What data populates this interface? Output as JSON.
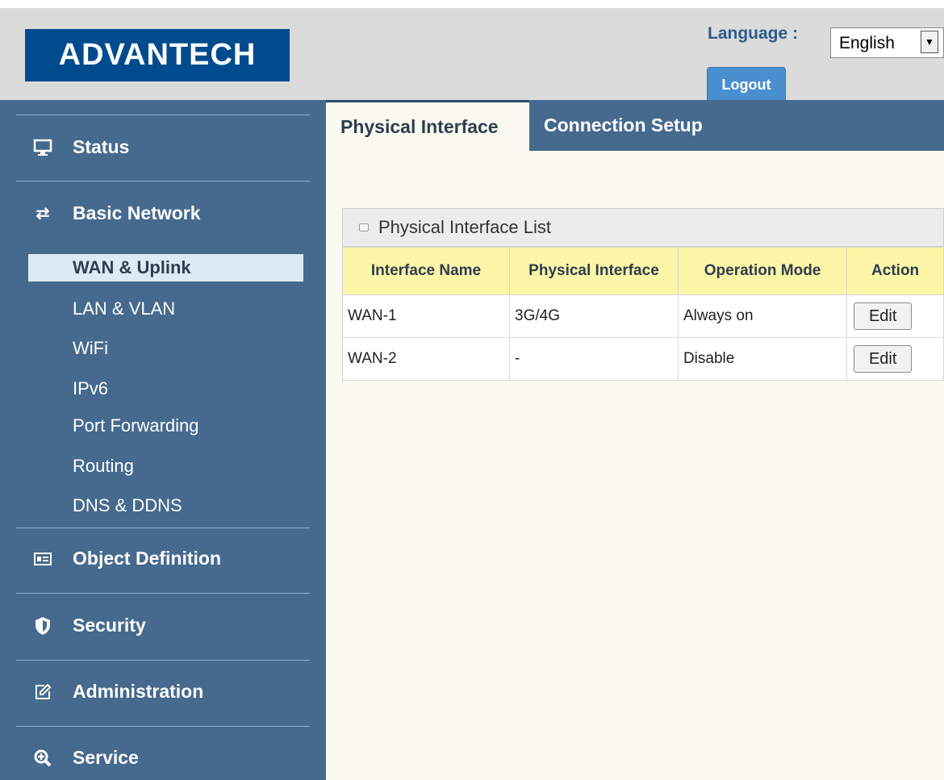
{
  "header": {
    "logo_text": "ADVANTECH",
    "language_label": "Language :",
    "language_value": "English",
    "logout_label": "Logout"
  },
  "sidebar": {
    "status": "Status",
    "basic_network": "Basic Network",
    "items": [
      "WAN & Uplink",
      "LAN & VLAN",
      "WiFi",
      "IPv6",
      "Port Forwarding",
      "Routing",
      "DNS & DDNS"
    ],
    "object_definition": "Object Definition",
    "security": "Security",
    "administration": "Administration",
    "service": "Service"
  },
  "tabs": [
    "Physical Interface",
    "Connection Setup"
  ],
  "panel": {
    "title": "Physical Interface List",
    "columns": [
      "Interface Name",
      "Physical Interface",
      "Operation Mode",
      "Action"
    ],
    "rows": [
      {
        "name": "WAN-1",
        "physical": "3G/4G",
        "mode": "Always on",
        "action": "Edit"
      },
      {
        "name": "WAN-2",
        "physical": "-",
        "mode": "Disable",
        "action": "Edit"
      }
    ]
  },
  "colors": {
    "brand": "#004b8d",
    "sidebar": "#456a8e",
    "header_row": "#fdf6a7"
  }
}
